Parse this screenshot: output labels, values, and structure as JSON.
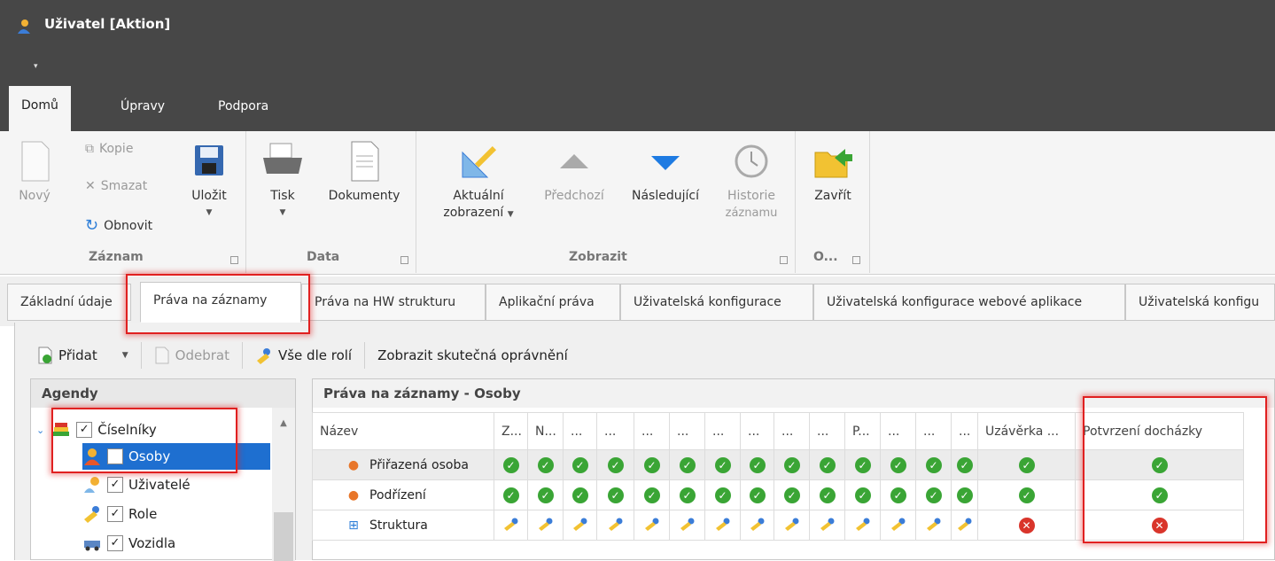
{
  "window": {
    "title": "Uživatel [Aktion]",
    "qat": "▾"
  },
  "ribbon_tabs": [
    "Domů",
    "Úpravy",
    "Podpora"
  ],
  "ribbon": {
    "zaznam": {
      "label": "Záznam",
      "novy": "Nový",
      "kopie": "Kopie",
      "smazat": "Smazat",
      "obnovit": "Obnovit",
      "ulozit": "Uložit"
    },
    "data": {
      "label": "Data",
      "tisk": "Tisk",
      "dokumenty": "Dokumenty"
    },
    "zobrazit": {
      "label": "Zobrazit",
      "aktualni1": "Aktuální",
      "aktualni2": "zobrazení",
      "predchozi": "Předchozí",
      "nasledujici": "Následující",
      "historie1": "Historie",
      "historie2": "záznamu"
    },
    "o": {
      "label": "O...",
      "zavrit": "Zavřít"
    }
  },
  "tabs": [
    "Základní údaje",
    "Práva na záznamy",
    "Práva na HW strukturu",
    "Aplikační práva",
    "Uživatelská konfigurace",
    "Uživatelská konfigurace webové aplikace",
    "Uživatelská konfigu"
  ],
  "toolbar": {
    "pridat": "Přidat",
    "odebrat": "Odebrat",
    "vse": "Vše dle rolí",
    "zobrazit": "Zobrazit skutečná oprávnění"
  },
  "agendy": {
    "title": "Agendy",
    "items": [
      "Číselníky",
      "Osoby",
      "Uživatelé",
      "Role",
      "Vozidla"
    ]
  },
  "grid": {
    "title": "Práva na záznamy - Osoby",
    "columns": [
      "Název",
      "Z...",
      "N...",
      "...",
      "...",
      "...",
      "...",
      "...",
      "...",
      "...",
      "...",
      "P...",
      "...",
      "...",
      "...",
      "Uzávěrka ...",
      "Potvrzení docházky"
    ],
    "rows": [
      {
        "name": "Přiřazená osoba",
        "cells": [
          "ok",
          "ok",
          "ok",
          "ok",
          "ok",
          "ok",
          "ok",
          "ok",
          "ok",
          "ok",
          "ok",
          "ok",
          "ok",
          "ok",
          "ok",
          "ok"
        ]
      },
      {
        "name": "Podřízení",
        "cells": [
          "ok",
          "ok",
          "ok",
          "ok",
          "ok",
          "ok",
          "ok",
          "ok",
          "ok",
          "ok",
          "ok",
          "ok",
          "ok",
          "ok",
          "ok",
          "ok"
        ]
      },
      {
        "name": "Struktura",
        "cells": [
          "key",
          "key",
          "key",
          "key",
          "key",
          "key",
          "key",
          "key",
          "key",
          "key",
          "key",
          "key",
          "key",
          "key",
          "no",
          "no"
        ]
      }
    ]
  },
  "colors": {
    "ok": "#3aa535",
    "no": "#d9352b",
    "highlight": "#e02020",
    "titlebar": "#474747"
  }
}
